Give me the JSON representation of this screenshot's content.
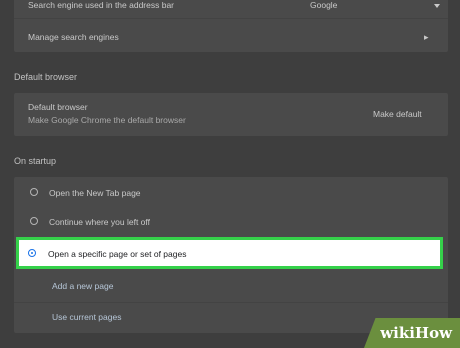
{
  "search": {
    "engine_label": "Search engine used in the address bar",
    "engine_value": "Google",
    "manage_label": "Manage search engines"
  },
  "default_browser": {
    "section_title": "Default browser",
    "title": "Default browser",
    "subtitle": "Make Google Chrome the default browser",
    "button_label": "Make default"
  },
  "on_startup": {
    "section_title": "On startup",
    "options": [
      {
        "label": "Open the New Tab page",
        "selected": false
      },
      {
        "label": "Continue where you left off",
        "selected": false
      },
      {
        "label": "Open a specific page or set of pages",
        "selected": true
      }
    ],
    "add_page_label": "Add a new page",
    "use_current_label": "Use current pages"
  },
  "watermark": {
    "text": "wikiHow"
  }
}
